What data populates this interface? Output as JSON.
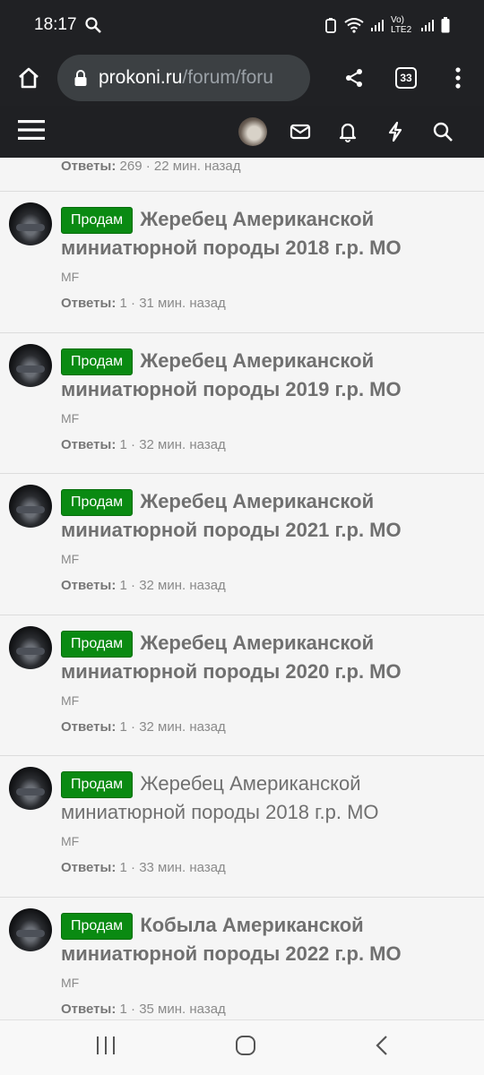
{
  "status": {
    "time": "18:17",
    "network": "Vo) LTE2"
  },
  "browser": {
    "url_host": "prokoni.ru",
    "url_path": "/forum/foru",
    "tab_count": "33"
  },
  "partial_thread": {
    "replies_label": "Ответы:",
    "replies": "269",
    "time": "22 мин. назад"
  },
  "threads": [
    {
      "prefix": "Продам",
      "title": "Жеребец Американской миниатюрной породы 2018 г.р. MO",
      "author": "MF",
      "replies_label": "Ответы:",
      "replies": "1",
      "time": "31 мин. назад",
      "unread": true
    },
    {
      "prefix": "Продам",
      "title": "Жеребец Американской миниатюрной породы 2019 г.р. MO",
      "author": "MF",
      "replies_label": "Ответы:",
      "replies": "1",
      "time": "32 мин. назад",
      "unread": true
    },
    {
      "prefix": "Продам",
      "title": "Жеребец Американской миниатюрной породы 2021 г.р. MO",
      "author": "MF",
      "replies_label": "Ответы:",
      "replies": "1",
      "time": "32 мин. назад",
      "unread": true
    },
    {
      "prefix": "Продам",
      "title": "Жеребец Американской миниатюрной породы 2020 г.р. MO",
      "author": "MF",
      "replies_label": "Ответы:",
      "replies": "1",
      "time": "32 мин. назад",
      "unread": true
    },
    {
      "prefix": "Продам",
      "title": "Жеребец Американской миниатюрной породы 2018 г.р. MO",
      "author": "MF",
      "replies_label": "Ответы:",
      "replies": "1",
      "time": "33 мин. назад",
      "unread": false
    },
    {
      "prefix": "Продам",
      "title": "Кобыла Американской миниатюрной породы 2022 г.р. MO",
      "author": "MF",
      "replies_label": "Ответы:",
      "replies": "1",
      "time": "35 мин. назад",
      "unread": true
    }
  ],
  "colors": {
    "prefix_green": "#0a8a12",
    "header_bg": "#1f2023",
    "browser_bg": "#202124"
  }
}
